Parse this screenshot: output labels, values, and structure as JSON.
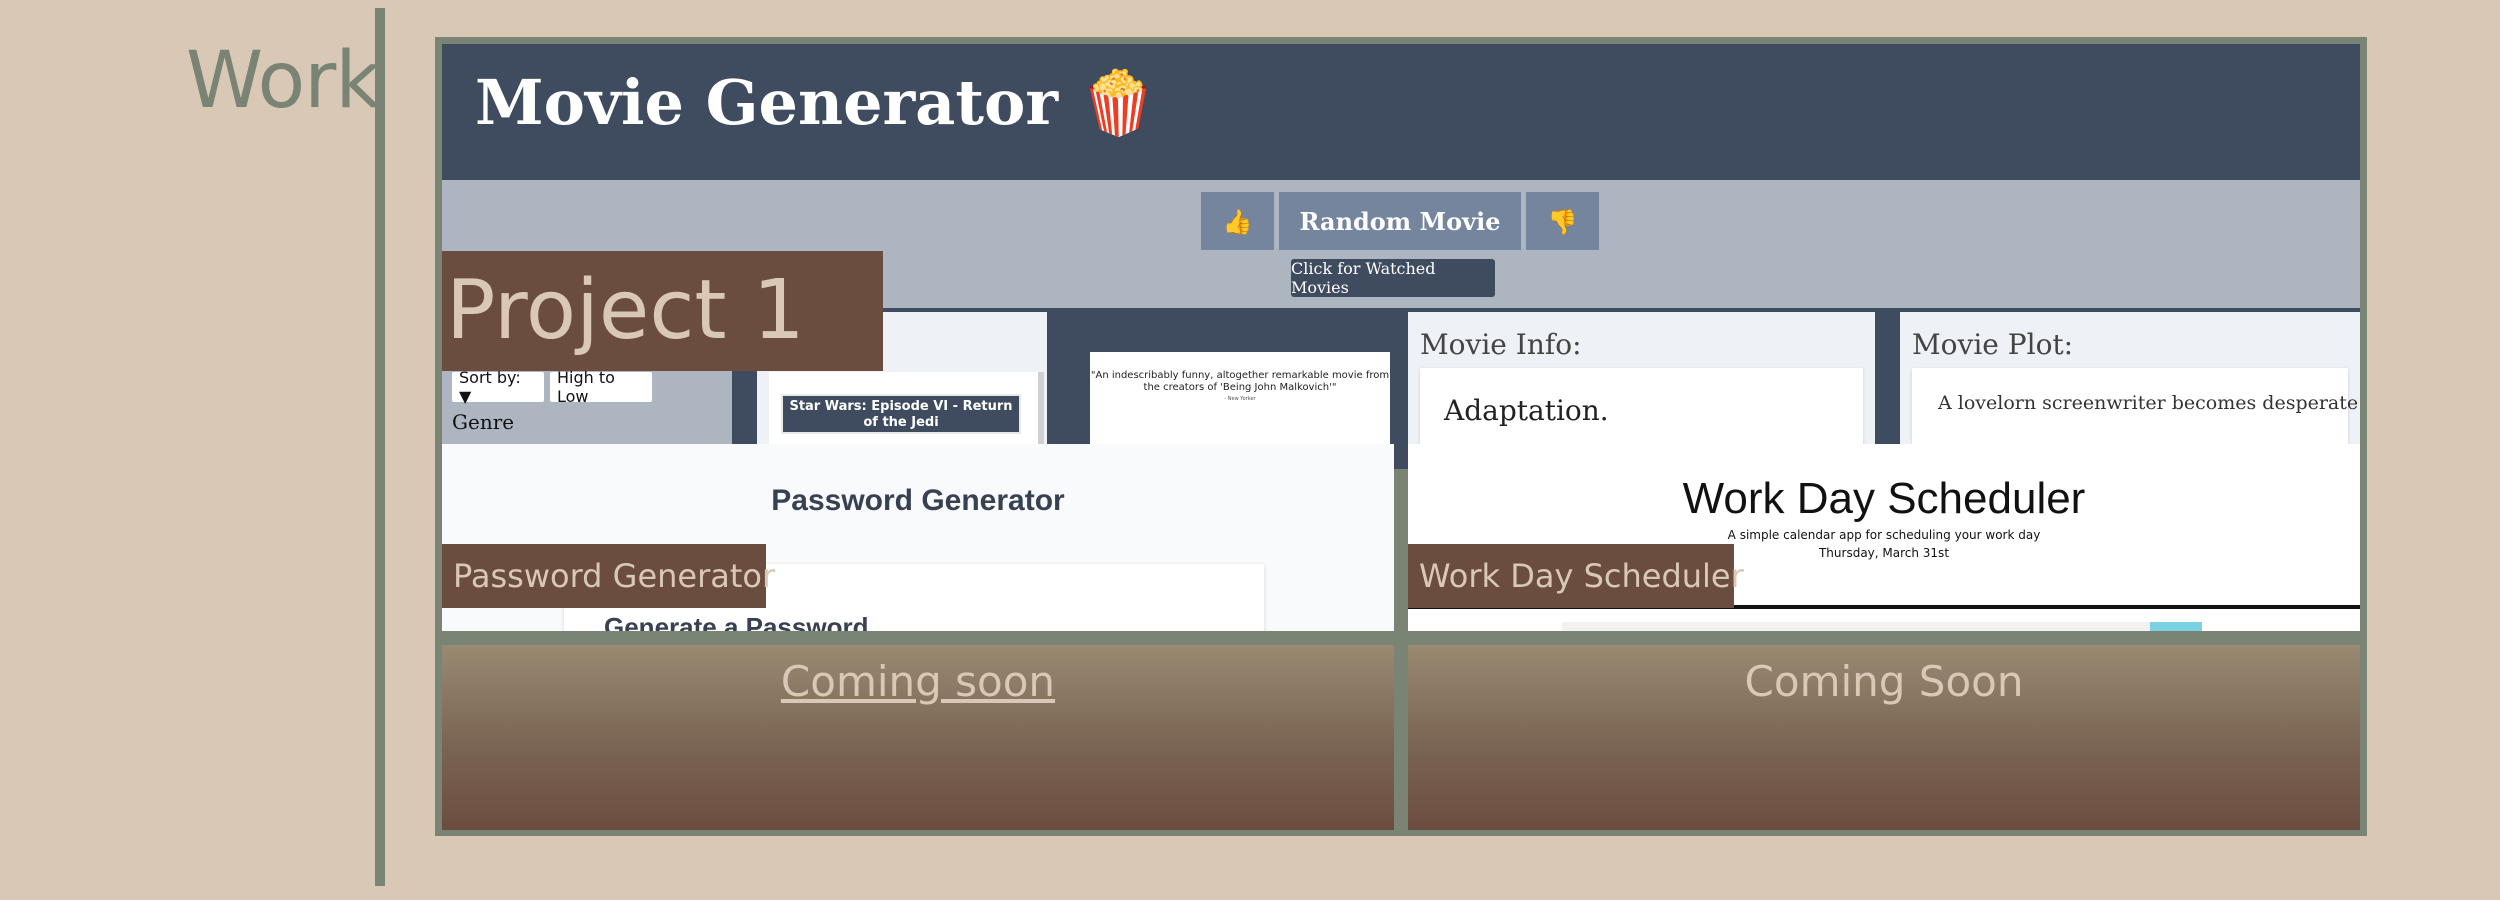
{
  "section": {
    "title": "Work"
  },
  "colors": {
    "background": "#d8c8b5",
    "accent": "#7a8474",
    "label_bg": "#6b4d3f",
    "header_bg": "#3f4b5e"
  },
  "projects": {
    "movie": {
      "label": "Project 1",
      "screenshot": {
        "title": "Movie Generator 🍿",
        "like_button": "👍",
        "random_button": "Random Movie",
        "dislike_button": "👎",
        "watched_button": "Click for Watched Movies",
        "sort_label": "Sort by: ▼",
        "sort_value": "High to Low",
        "genre_label": "Genre",
        "movie_item": "Star Wars: Episode VI - Return of the Jedi",
        "poster_quote": "\"An indescribably funny, altogether remarkable movie from the creators of 'Being John Malkovich'\"",
        "poster_sub": "- New Yorker",
        "info_heading": "Movie Info:",
        "info_value": "Adaptation.",
        "plot_heading": "Movie Plot:",
        "plot_text": "A lovelorn screenwriter becomes desperate as he"
      }
    },
    "password": {
      "label": "Password Generator",
      "screenshot": {
        "title": "Password Generator",
        "card_title": "Generate a Password"
      }
    },
    "scheduler": {
      "label": "Work Day Scheduler",
      "screenshot": {
        "title": "Work Day Scheduler",
        "subtitle": "A simple calendar app for scheduling your work day",
        "date": "Thursday, March 31st"
      }
    },
    "coming_1": {
      "label": "Coming soon"
    },
    "coming_2": {
      "label": "Coming Soon"
    }
  }
}
